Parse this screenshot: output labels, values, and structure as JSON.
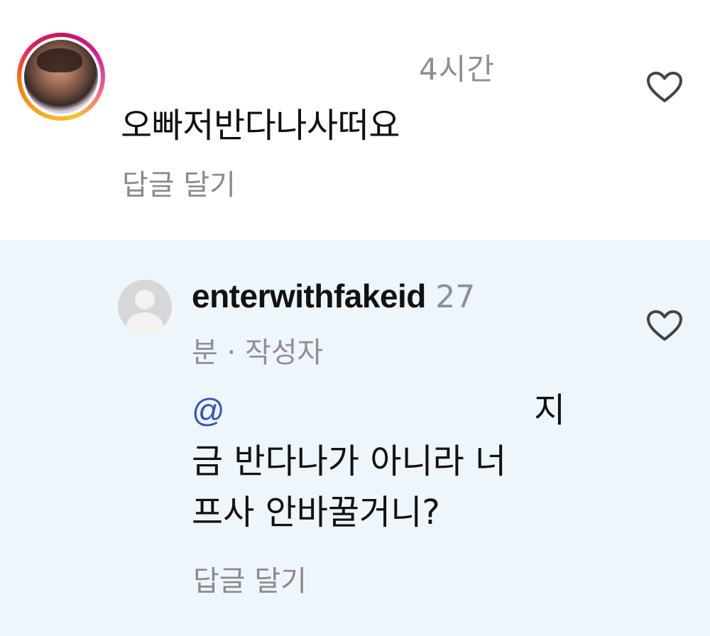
{
  "top_comment": {
    "time": "4시간",
    "text": "오빠저반다나사떠요",
    "reply_label": "답글 달기",
    "like_icon": "heart-outline-icon"
  },
  "reply_comment": {
    "username": "enterwithfakeid",
    "time": "27",
    "meta": "분 · 작성자",
    "mention": "@",
    "lines": [
      "지",
      "금 반다나가 아니라 너",
      "프사 안바꿀거니?"
    ],
    "reply_label": "답글 달기",
    "like_icon": "heart-outline-icon"
  },
  "colors": {
    "reply_background": "#eef5fb",
    "secondary_text": "#8e8e93",
    "mention": "#3556b8",
    "story_ring": [
      "#f9a825",
      "#e91e63",
      "#d81b9b"
    ]
  }
}
